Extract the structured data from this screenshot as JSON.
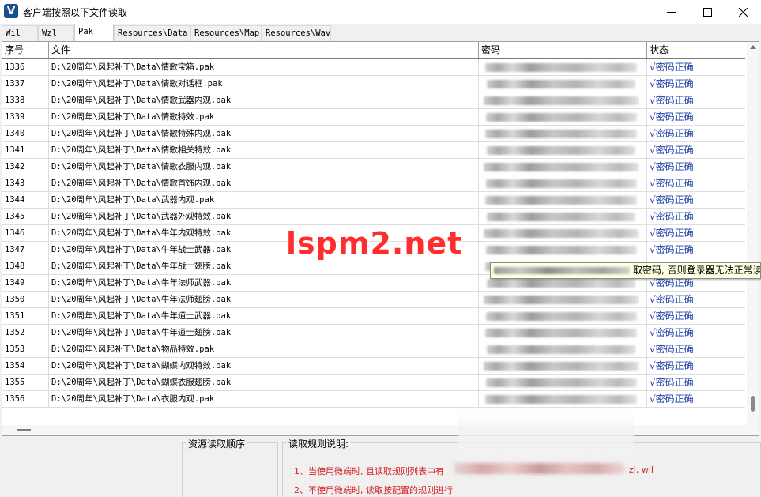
{
  "window": {
    "title": "客户端按照以下文件读取",
    "app_icon_letter": "V"
  },
  "tabs": [
    {
      "label": "Wil",
      "active": false
    },
    {
      "label": "Wzl",
      "active": false
    },
    {
      "label": "Pak",
      "active": true
    },
    {
      "label": "Resources\\Data",
      "active": false
    },
    {
      "label": "Resources\\Map",
      "active": false
    },
    {
      "label": "Resources\\Wav",
      "active": false
    }
  ],
  "table": {
    "columns": [
      "序号",
      "文件",
      "密码",
      "状态"
    ],
    "rows": [
      {
        "id": "1336",
        "file": "D:\\20周年\\风起补丁\\Data\\情歌宝箱.pak",
        "status": "√密码正确"
      },
      {
        "id": "1337",
        "file": "D:\\20周年\\风起补丁\\Data\\情歌对话框.pak",
        "status": "√密码正确"
      },
      {
        "id": "1338",
        "file": "D:\\20周年\\风起补丁\\Data\\情歌武器内观.pak",
        "status": "√密码正确"
      },
      {
        "id": "1339",
        "file": "D:\\20周年\\风起补丁\\Data\\情歌特效.pak",
        "status": "√密码正确"
      },
      {
        "id": "1340",
        "file": "D:\\20周年\\风起补丁\\Data\\情歌特殊内观.pak",
        "status": "√密码正确"
      },
      {
        "id": "1341",
        "file": "D:\\20周年\\风起补丁\\Data\\情歌相关特效.pak",
        "status": "√密码正确"
      },
      {
        "id": "1342",
        "file": "D:\\20周年\\风起补丁\\Data\\情歌衣服内观.pak",
        "status": "√密码正确"
      },
      {
        "id": "1343",
        "file": "D:\\20周年\\风起补丁\\Data\\情歌首饰内观.pak",
        "status": "√密码正确"
      },
      {
        "id": "1344",
        "file": "D:\\20周年\\风起补丁\\Data\\武器内观.pak",
        "status": "√密码正确"
      },
      {
        "id": "1345",
        "file": "D:\\20周年\\风起补丁\\Data\\武器外观特效.pak",
        "status": "√密码正确"
      },
      {
        "id": "1346",
        "file": "D:\\20周年\\风起补丁\\Data\\牛年内观特效.pak",
        "status": "√密码正确"
      },
      {
        "id": "1347",
        "file": "D:\\20周年\\风起补丁\\Data\\牛年战士武器.pak",
        "status": "√密码正确"
      },
      {
        "id": "1348",
        "file": "D:\\20周年\\风起补丁\\Data\\牛年战士翅膀.pak",
        "status": ""
      },
      {
        "id": "1349",
        "file": "D:\\20周年\\风起补丁\\Data\\牛年法师武器.pak",
        "status": "√密码正确"
      },
      {
        "id": "1350",
        "file": "D:\\20周年\\风起补丁\\Data\\牛年法师翅膀.pak",
        "status": "√密码正确"
      },
      {
        "id": "1351",
        "file": "D:\\20周年\\风起补丁\\Data\\牛年道士武器.pak",
        "status": "√密码正确"
      },
      {
        "id": "1352",
        "file": "D:\\20周年\\风起补丁\\Data\\牛年道士翅膀.pak",
        "status": "√密码正确"
      },
      {
        "id": "1353",
        "file": "D:\\20周年\\风起补丁\\Data\\物品特效.pak",
        "status": "√密码正确"
      },
      {
        "id": "1354",
        "file": "D:\\20周年\\风起补丁\\Data\\蝴蝶内观特效.pak",
        "status": "√密码正确"
      },
      {
        "id": "1355",
        "file": "D:\\20周年\\风起补丁\\Data\\蝴蝶衣服翅膀.pak",
        "status": "√密码正确"
      },
      {
        "id": "1356",
        "file": "D:\\20周年\\风起补丁\\Data\\衣服内观.pak",
        "status": "√密码正确"
      }
    ]
  },
  "tooltip": {
    "visible_text": "取密码, 否则登录器无法正常读"
  },
  "watermark": "lspm2.net",
  "bottom": {
    "left_group_label": "资源读取顺序",
    "right_group_label": "读取规则说明:",
    "rule_1_start": "1、当使用微端时, 且读取规则列表中有",
    "rule_1_end": "zl, wil",
    "rule_2": "2、不使用微端时, 读取按配置的规则进行"
  },
  "colors": {
    "status_text": "#1c3fa8",
    "rule_text": "#d42020",
    "watermark": "#ff2d2d",
    "tooltip_bg": "#ffffe1"
  }
}
